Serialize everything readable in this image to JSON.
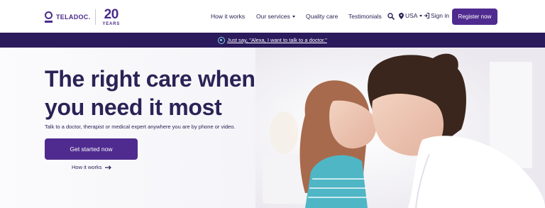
{
  "header": {
    "logo_text": "TELADOC.",
    "anniversary_number": "20",
    "anniversary_label": "YEARS",
    "nav": [
      {
        "label": "How it works",
        "has_caret": false
      },
      {
        "label": "Our services",
        "has_caret": true
      },
      {
        "label": "Quality care",
        "has_caret": false
      },
      {
        "label": "Testimonials",
        "has_caret": false
      }
    ],
    "country": "USA",
    "sign_in": "Sign in",
    "register": "Register now"
  },
  "banner": {
    "text": "Just say, \"Alexa, I want to talk to a doctor.\""
  },
  "hero": {
    "headline": "The right care when you need it most",
    "subtext": "Talk to a doctor, therapist or medical expert anywhere you are by phone or video.",
    "cta": "Get started now",
    "secondary_link": "How it works"
  },
  "colors": {
    "brand_purple": "#4f2b8f",
    "banner_bg": "#2b1a5c",
    "text_dark": "#2b2356"
  }
}
